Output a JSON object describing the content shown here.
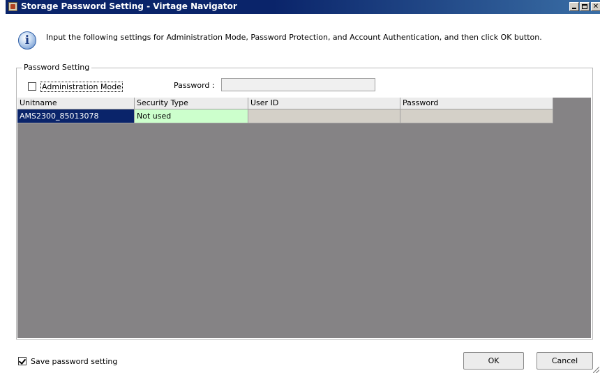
{
  "window": {
    "title": "Storage Password Setting - Virtage Navigator"
  },
  "info": {
    "icon": "info-icon",
    "text": "Input the following settings for Administration Mode, Password Protection, and Account Authentication, and then click OK button."
  },
  "password_setting": {
    "legend": "Password Setting",
    "admin_mode_label": "Administration Mode",
    "admin_mode_checked": false,
    "password_label": "Password :",
    "password_value": ""
  },
  "grid": {
    "columns": [
      "Unitname",
      "Security Type",
      "User ID",
      "Password"
    ],
    "rows": [
      [
        "AMS2300_85013078",
        "Not used",
        "",
        ""
      ]
    ]
  },
  "footer": {
    "save_label": "Save password setting",
    "save_checked": true,
    "ok_label": "OK",
    "cancel_label": "Cancel"
  },
  "colors": {
    "titlebar": "#0a246a",
    "selected_cell": "#0a246a",
    "security_cell": "#ccffcc",
    "grid_background": "#858385"
  }
}
